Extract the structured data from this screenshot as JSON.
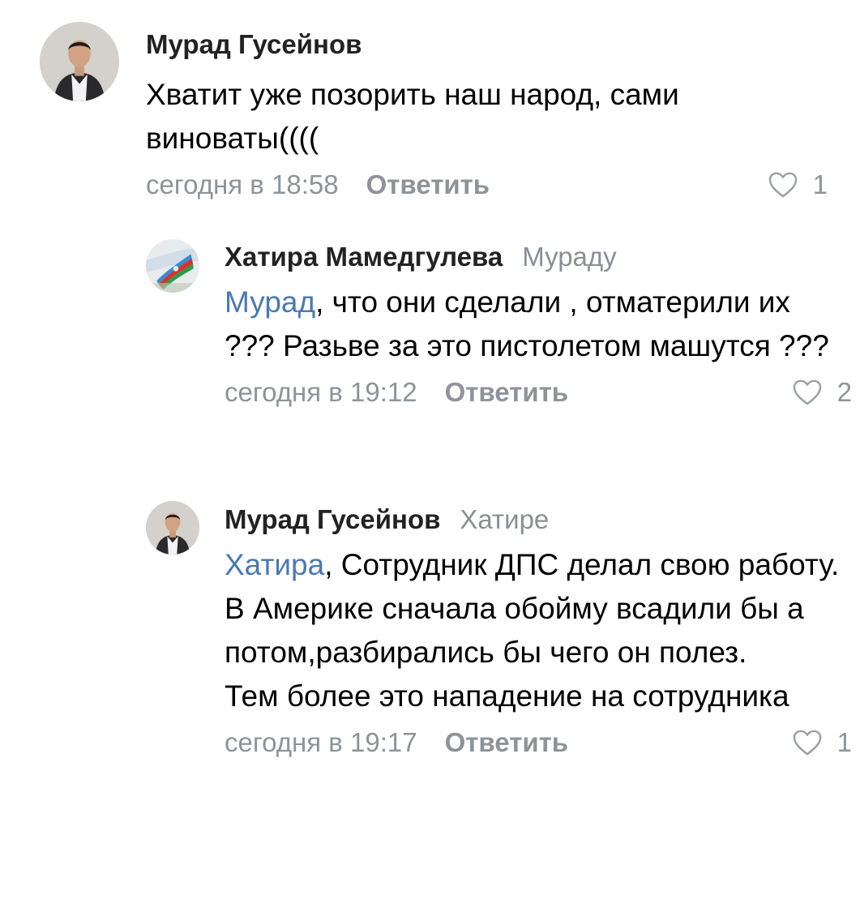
{
  "comments": [
    {
      "author": "Мурад Гусейнов",
      "reply_to": "",
      "mention": "",
      "lines": [
        "Хватит уже позорить наш народ, сами виноваты(((("
      ],
      "time": "сегодня в 18:58",
      "reply_label": "Ответить",
      "likes": "1"
    },
    {
      "author": "Хатира Мамедгулева",
      "reply_to": "Мураду",
      "mention": "Мурад",
      "lines": [
        ",  что они сделали , отматерили их ??? Разьве за это  пистолетом машутся ???"
      ],
      "time": "сегодня в 19:12",
      "reply_label": "Ответить",
      "likes": "2"
    },
    {
      "author": "Мурад Гусейнов",
      "reply_to": "Хатире",
      "mention": "Хатира",
      "lines": [
        ", Сотрудник ДПС делал свою работу.",
        "В Америке сначала обойму всадили бы а потом,разбирались бы чего он полез.",
        "Тем более это нападение на сотрудника"
      ],
      "time": "сегодня в 19:17",
      "reply_label": "Ответить",
      "likes": "1"
    }
  ],
  "colors": {
    "mention": "#4a79b1",
    "meta": "#8e939a",
    "author": "#222222"
  },
  "icons": [
    "avatar-photo",
    "flag-avatar",
    "heart-outline-icon"
  ]
}
